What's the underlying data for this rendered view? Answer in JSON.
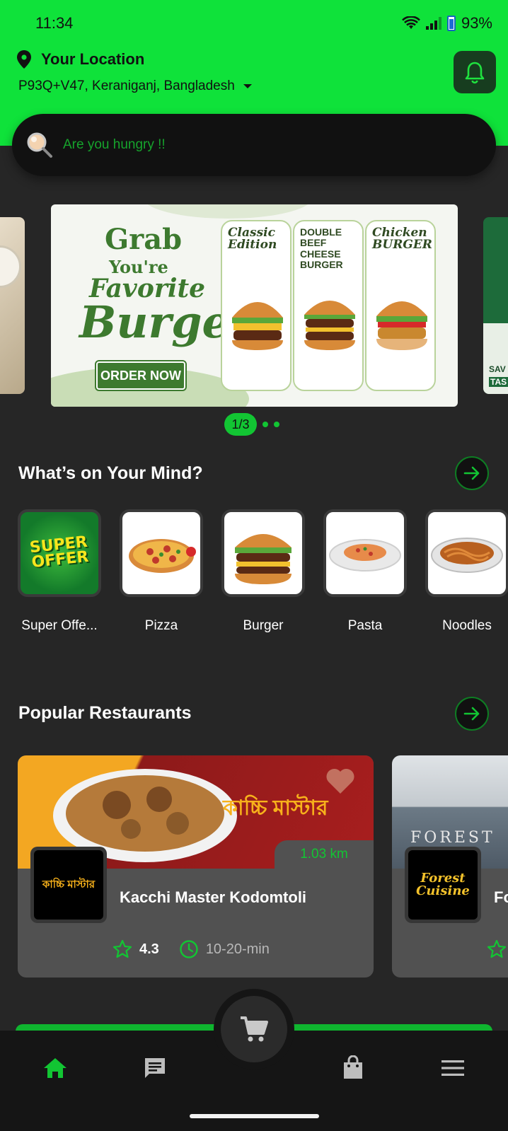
{
  "status_bar": {
    "time": "11:34",
    "battery": "93%"
  },
  "header": {
    "location_title": "Your Location",
    "address": "P93Q+V47, Keraniganj, Bangladesh"
  },
  "search": {
    "placeholder": "Are you hungry !!"
  },
  "banner": {
    "line1": "Grab",
    "line2": "You're",
    "line3": "Favorite",
    "line4": "Burger",
    "cta": "ORDER NOW",
    "cards": [
      {
        "label": "Classic Edition"
      },
      {
        "label": "DOUBLE BEEF CHEESE BURGER"
      },
      {
        "label": "Chicken BURGER"
      }
    ],
    "next_peek_text1": "SAV",
    "next_peek_text2": "TAS"
  },
  "pager": {
    "label": "1/3"
  },
  "sections": {
    "mind_title": "What’s on Your Mind?",
    "popular_title": "Popular Restaurants"
  },
  "categories": [
    {
      "label": "Super Offe...",
      "badge": "SUPER OFFER"
    },
    {
      "label": "Pizza"
    },
    {
      "label": "Burger"
    },
    {
      "label": "Pasta"
    },
    {
      "label": "Noodles"
    }
  ],
  "restaurants": [
    {
      "name": "Kacchi Master Kodomtoli",
      "distance": "1.03 km",
      "rating": "4.3",
      "time": "10-20-min",
      "brand_text": "কাচ্চি মাস্টার"
    },
    {
      "name": "Fo",
      "logo_text": "Forest Cuisine",
      "sign_text": "FOREST"
    }
  ],
  "colors": {
    "accent": "#0fe23a",
    "bg": "#262626",
    "card": "#515151"
  }
}
